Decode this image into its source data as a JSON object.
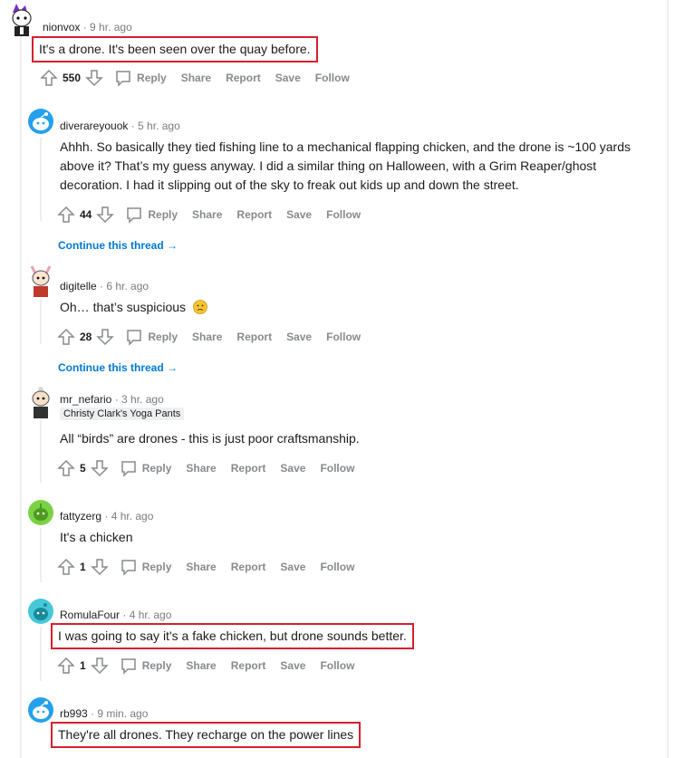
{
  "colors": {
    "highlight": "#d61f2c",
    "link": "#0079d3",
    "muted": "#878a8c",
    "thread": "#edeff1"
  },
  "actions": {
    "reply": "Reply",
    "share": "Share",
    "report": "Report",
    "save": "Save",
    "follow": "Follow"
  },
  "continue_label": "Continue this thread",
  "comments": [
    {
      "username": "nionvox",
      "time": "9 hr. ago",
      "body": "It's a drone. It's been seen over the quay before.",
      "score": "550",
      "highlighted": true
    },
    {
      "username": "diverareyouok",
      "time": "5 hr. ago",
      "body": "Ahhh. So basically they tied fishing line to a mechanical flapping chicken, and the drone is ~100 yards above it? That’s my guess anyway. I did a similar thing on Halloween, with a Grim Reaper/ghost decoration. I had it slipping out of the sky to freak out kids up and down the street.",
      "score": "44",
      "highlighted": false
    },
    {
      "username": "digitelle",
      "time": "6 hr. ago",
      "body": "Oh… that’s suspicious",
      "emoji": "slightly-frowning-face",
      "score": "28",
      "highlighted": false
    },
    {
      "username": "mr_nefario",
      "time": "3 hr. ago",
      "flair": "Christy Clark's Yoga Pants",
      "body": "All “birds” are drones - this is just poor craftsmanship.",
      "score": "5",
      "highlighted": false
    },
    {
      "username": "fattyzerg",
      "time": "4 hr. ago",
      "body": "It's a chicken",
      "score": "1",
      "highlighted": false
    },
    {
      "username": "RomulaFour",
      "time": "4 hr. ago",
      "body": "I was going to say it's a fake chicken, but drone sounds better.",
      "score": "1",
      "highlighted": true
    },
    {
      "username": "rb993",
      "time": "9 min. ago",
      "body": "They're all drones. They recharge on the power lines",
      "highlighted": true
    }
  ]
}
